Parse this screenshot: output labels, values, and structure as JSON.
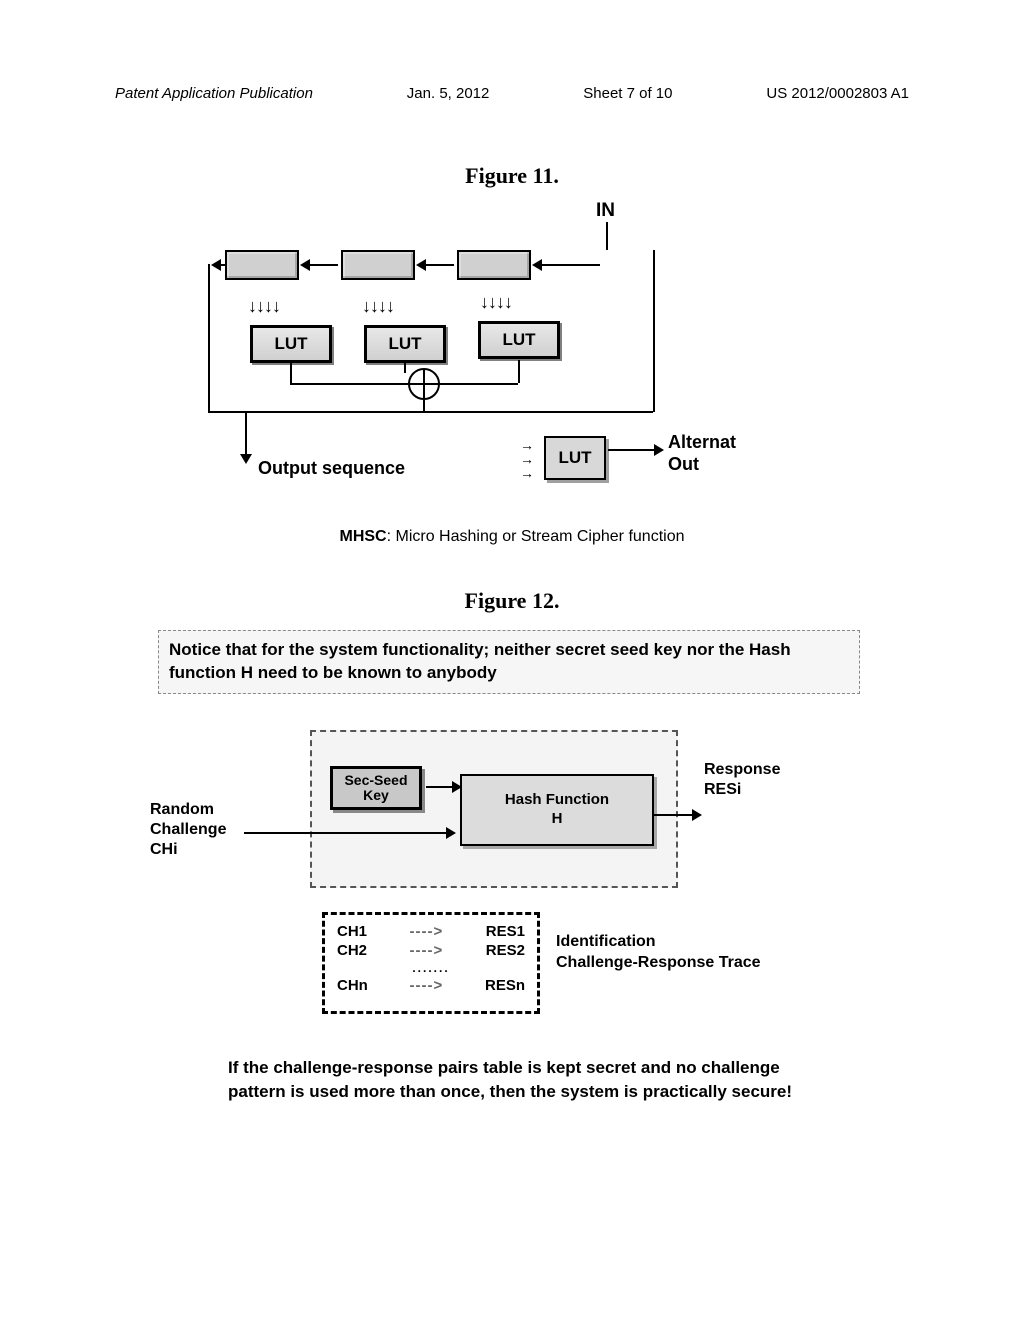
{
  "header": {
    "left": "Patent Application Publication",
    "date": "Jan. 5, 2012",
    "sheet": "Sheet 7 of 10",
    "pubno": "US 2012/0002803 A1"
  },
  "fig11": {
    "title": "Figure 11.",
    "in_label": "IN",
    "lut_label": "LUT",
    "output_sequence": "Output sequence",
    "alternat": "Alternat",
    "out": "Out",
    "caption_bold": "MHSC",
    "caption_rest": ": Micro Hashing or Stream Cipher function"
  },
  "fig12": {
    "title": "Figure 12.",
    "notice": "Notice that for the system functionality; neither secret seed key nor the Hash function H need to be known to anybody",
    "seed_key": "Sec-Seed Key",
    "hash_fn": "Hash Function H",
    "random_challenge": "Random Challenge CHi",
    "response": "Response RESi",
    "identification": "Identification Challenge-Response Trace",
    "table": [
      {
        "ch": "CH1",
        "res": "RES1"
      },
      {
        "ch": "CH2",
        "res": "RES2"
      },
      {
        "ch": "CHn",
        "res": "RESn"
      }
    ],
    "footer": "If the challenge-response pairs table is kept secret and no challenge pattern is used more than once, then the system is practically secure!"
  }
}
